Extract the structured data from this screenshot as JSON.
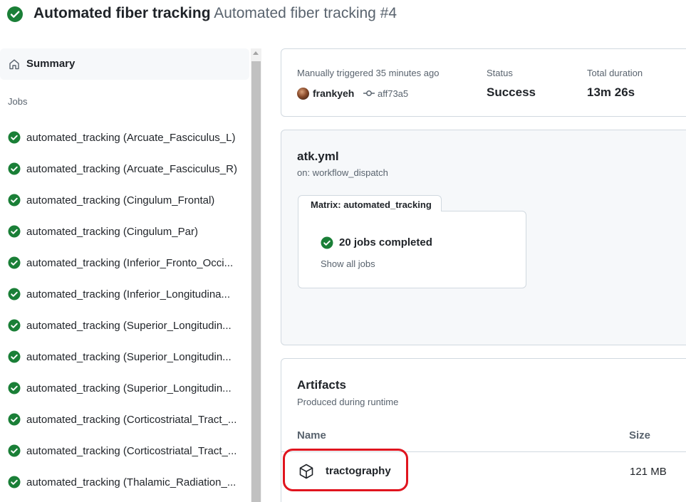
{
  "header": {
    "workflow_name": "Automated fiber tracking",
    "run_title": "Automated fiber tracking #4",
    "status_icon": "check-circle-fill-icon",
    "status_color": "#1a7f37"
  },
  "sidebar": {
    "summary_label": "Summary",
    "summary_icon": "home-icon",
    "jobs_heading": "Jobs",
    "jobs": [
      {
        "label": "automated_tracking (Arcuate_Fasciculus_L)"
      },
      {
        "label": "automated_tracking (Arcuate_Fasciculus_R)"
      },
      {
        "label": "automated_tracking (Cingulum_Frontal)"
      },
      {
        "label": "automated_tracking (Cingulum_Par)"
      },
      {
        "label": "automated_tracking (Inferior_Fronto_Occi..."
      },
      {
        "label": "automated_tracking (Inferior_Longitudina..."
      },
      {
        "label": "automated_tracking (Superior_Longitudin..."
      },
      {
        "label": "automated_tracking (Superior_Longitudin..."
      },
      {
        "label": "automated_tracking (Superior_Longitudin..."
      },
      {
        "label": "automated_tracking (Corticostriatal_Tract_..."
      },
      {
        "label": "automated_tracking (Corticostriatal_Tract_..."
      },
      {
        "label": "automated_tracking (Thalamic_Radiation_..."
      }
    ]
  },
  "run_summary": {
    "trigger_text": "Manually triggered 35 minutes ago",
    "user": "frankyeh",
    "commit": "aff73a5",
    "status_label": "Status",
    "status_value": "Success",
    "duration_label": "Total duration",
    "duration_value": "13m 26s"
  },
  "workflow": {
    "file": "atk.yml",
    "trigger": "on: workflow_dispatch",
    "matrix_tab": "Matrix: automated_tracking",
    "completed": "20 jobs completed",
    "show_all": "Show all jobs"
  },
  "artifacts": {
    "title": "Artifacts",
    "subtitle": "Produced during runtime",
    "col_name": "Name",
    "col_size": "Size",
    "items": [
      {
        "name": "tractography",
        "size": "121 MB",
        "icon": "package-icon"
      }
    ],
    "highlight_color": "#e0141e"
  }
}
